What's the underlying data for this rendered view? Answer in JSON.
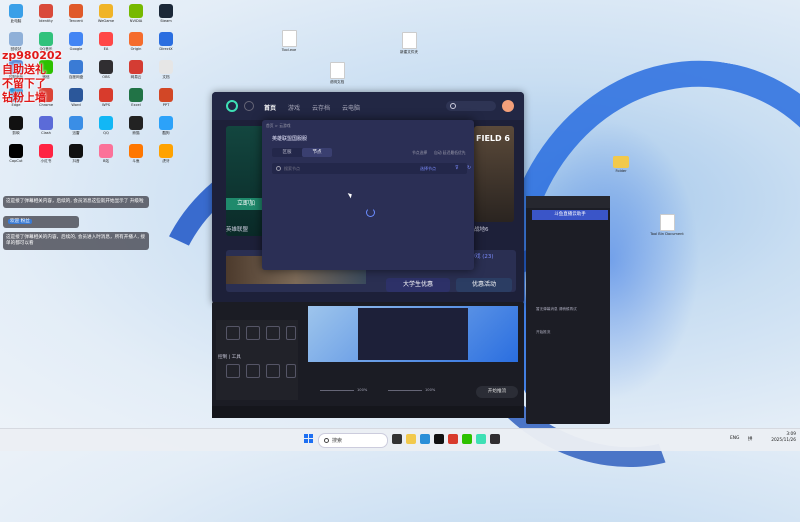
{
  "overlay": {
    "red_lines": [
      "zp980202",
      "自助送礼",
      "不留下了",
      "钻粉上墙"
    ]
  },
  "chat": {
    "msg1": "这是接了弹幕相关内容，后续的, 会员消息这些就开始显示了 升级啦",
    "msg2_tag": "欢迎 粉丝",
    "msg3": "这是接了弹幕相关的内容，后续的, 会员进入时消息，所有开播人, 接单的都可以看"
  },
  "desktop": {
    "icons": [
      {
        "label": "此电脑",
        "color": "#3aa0e8"
      },
      {
        "label": "Identity",
        "color": "#d94a3a"
      },
      {
        "label": "Tencent",
        "color": "#e05a2a"
      },
      {
        "label": "WeGame",
        "color": "#f0b428"
      },
      {
        "label": "NVIDIA",
        "color": "#76b900"
      },
      {
        "label": "Steam",
        "color": "#1b2838"
      },
      {
        "label": "回收站",
        "color": "#8fb0d8"
      },
      {
        "label": "QQ音乐",
        "color": "#31c27c"
      },
      {
        "label": "Google",
        "color": "#4285f4"
      },
      {
        "label": "EA",
        "color": "#ff4747"
      },
      {
        "label": "Origin",
        "color": "#f56c2d"
      },
      {
        "label": "DirectX",
        "color": "#2a6ee0"
      },
      {
        "label": "控制面板",
        "color": "#5b8bd8"
      },
      {
        "label": "微信",
        "color": "#2dc100"
      },
      {
        "label": "百度网盘",
        "color": "#3a7bd5"
      },
      {
        "label": "OBS",
        "color": "#302e31"
      },
      {
        "label": "网易云",
        "color": "#d43c33"
      },
      {
        "label": "文档",
        "color": "#e6e6e6"
      },
      {
        "label": "Edge",
        "color": "#2a8fd8"
      },
      {
        "label": "Chrome",
        "color": "#db4437"
      },
      {
        "label": "Word",
        "color": "#2b579a"
      },
      {
        "label": "WPS",
        "color": "#d83b2c"
      },
      {
        "label": "Excel",
        "color": "#217346"
      },
      {
        "label": "PPT",
        "color": "#d24726"
      },
      {
        "label": "剪映",
        "color": "#111111"
      },
      {
        "label": "Clash",
        "color": "#5b6bd8"
      },
      {
        "label": "迅雷",
        "color": "#3a8ee6"
      },
      {
        "label": "QQ",
        "color": "#12b7f5"
      },
      {
        "label": "熊猫",
        "color": "#222222"
      },
      {
        "label": "酷狗",
        "color": "#2ca2f9"
      },
      {
        "label": "CapCut",
        "color": "#000000"
      },
      {
        "label": "小红书",
        "color": "#ff2442"
      },
      {
        "label": "抖音",
        "color": "#111111"
      },
      {
        "label": "B站",
        "color": "#fb7299"
      },
      {
        "label": "斗鱼",
        "color": "#ff7700"
      },
      {
        "label": "虎牙",
        "color": "#ffa200"
      }
    ]
  },
  "free_icons": [
    {
      "label": "Tool.exe"
    },
    {
      "label": "说明文档"
    },
    {
      "label": "新建文件夹"
    },
    {
      "label": "Tool Bin Document"
    },
    {
      "label": "Folder"
    }
  ],
  "app": {
    "nav": [
      "首页",
      "游戏",
      "云存档",
      "云电脑"
    ],
    "card1_button": "立即加",
    "card1_label": "英雄联盟",
    "card2_title": "FIELD 6",
    "card2_label": "战地6",
    "strip_counter": "的游戏 (23)",
    "pill1": "大学生优惠",
    "pill2": "优惠活动"
  },
  "dialog": {
    "crumbs": "首页 > 云游戏",
    "title": "英雄联盟国服服",
    "seg_left": "区服",
    "seg_right": "节点",
    "right_a": "节点选择",
    "right_b": "自动 延迟最低优先",
    "search_placeholder": "搜索节点",
    "search_right": "选择节点"
  },
  "obs": {
    "section": "控制 | 工具",
    "slider1_val": "100%",
    "slider2_val": "100%",
    "start_btn": "开始推流"
  },
  "browser": {
    "header": "斗鱼直播云助手",
    "msg": "暂无弹幕消息 请稍候再试",
    "msg2": "开始推流"
  },
  "taskbar": {
    "search_text": "搜索",
    "tray": [
      "ENG",
      "拼"
    ],
    "time": "3:09",
    "date": "2025/11/26"
  }
}
